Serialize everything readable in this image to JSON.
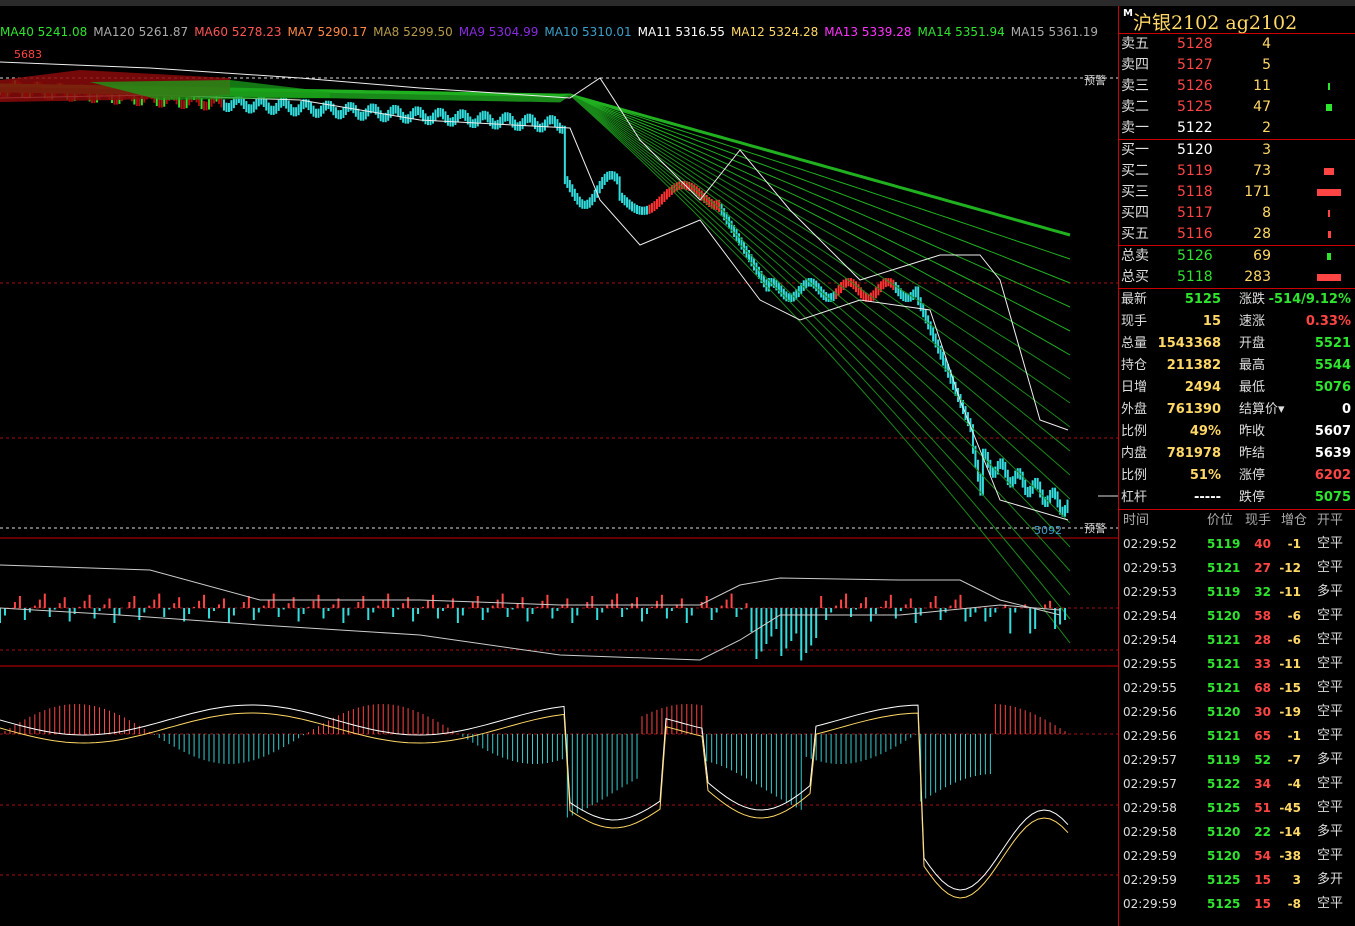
{
  "instrument": {
    "marker": "M",
    "name": "沪银2102  ag2102"
  },
  "ma_legend": [
    {
      "text": "MA40 5241.08",
      "color": "#2ee52e"
    },
    {
      "text": "MA120 5261.87",
      "color": "#aaaaaa"
    },
    {
      "text": "MA60 5278.23",
      "color": "#ff5555"
    },
    {
      "text": "MA7 5290.17",
      "color": "#ff8844"
    },
    {
      "text": "MA8 5299.50",
      "color": "#b59a4a"
    },
    {
      "text": "MA9 5304.99",
      "color": "#8a2be2"
    },
    {
      "text": "MA10 5310.01",
      "color": "#3aa0c8"
    },
    {
      "text": "MA11 5316.55",
      "color": "#ffffff"
    },
    {
      "text": "MA12 5324.28",
      "color": "#ffd866"
    },
    {
      "text": "MA13 5339.28",
      "color": "#ff33ff"
    },
    {
      "text": "MA14 5351.94",
      "color": "#2ee52e"
    },
    {
      "text": "MA15 5361.19",
      "color": "#aaaaaa"
    }
  ],
  "chart": {
    "high_label": "5683",
    "low_label": "5092",
    "alert_label": "预警"
  },
  "orderbook": {
    "asks": [
      {
        "label": "卖五",
        "price": "5128",
        "vol": "4",
        "bar": 0
      },
      {
        "label": "卖四",
        "price": "5127",
        "vol": "5",
        "bar": 0
      },
      {
        "label": "卖三",
        "price": "5126",
        "vol": "11",
        "bar": 2
      },
      {
        "label": "卖二",
        "price": "5125",
        "vol": "47",
        "bar": 6
      },
      {
        "label": "卖一",
        "price": "5122",
        "vol": "2",
        "bar": 0
      }
    ],
    "bids": [
      {
        "label": "买一",
        "price": "5120",
        "vol": "3",
        "bar": 0
      },
      {
        "label": "买二",
        "price": "5119",
        "vol": "73",
        "bar": 10
      },
      {
        "label": "买三",
        "price": "5118",
        "vol": "171",
        "bar": 24
      },
      {
        "label": "买四",
        "price": "5117",
        "vol": "8",
        "bar": 2
      },
      {
        "label": "买五",
        "price": "5116",
        "vol": "28",
        "bar": 3
      }
    ],
    "totals": [
      {
        "label": "总卖",
        "price": "5126",
        "vol": "69",
        "bar": 4
      },
      {
        "label": "总买",
        "price": "5118",
        "vol": "283",
        "bar": 24
      }
    ]
  },
  "stats": [
    {
      "l1": "最新",
      "v1": "5125",
      "c1": "green",
      "l2": "涨跌",
      "v2": "-514/9.12%",
      "c2": "green"
    },
    {
      "l1": "现手",
      "v1": "15",
      "c1": "yellow",
      "l2": "速涨",
      "v2": "0.33%",
      "c2": "red"
    },
    {
      "l1": "总量",
      "v1": "1543368",
      "c1": "yellow",
      "l2": "开盘",
      "v2": "5521",
      "c2": "green"
    },
    {
      "l1": "持仓",
      "v1": "211382",
      "c1": "yellow",
      "l2": "最高",
      "v2": "5544",
      "c2": "green"
    },
    {
      "l1": "日增",
      "v1": "2494",
      "c1": "yellow",
      "l2": "最低",
      "v2": "5076",
      "c2": "green"
    },
    {
      "l1": "外盘",
      "v1": "761390",
      "c1": "yellow",
      "l2": "结算价▾",
      "v2": "0",
      "c2": "white"
    },
    {
      "l1": "比例",
      "v1": "49%",
      "c1": "yellow",
      "l2": "昨收",
      "v2": "5607",
      "c2": "white"
    },
    {
      "l1": "内盘",
      "v1": "781978",
      "c1": "yellow",
      "l2": "昨结",
      "v2": "5639",
      "c2": "white"
    },
    {
      "l1": "比例",
      "v1": "51%",
      "c1": "yellow",
      "l2": "涨停",
      "v2": "6202",
      "c2": "red"
    },
    {
      "l1": "杠杆",
      "v1": "-----",
      "c1": "white",
      "l2": "跌停",
      "v2": "5075",
      "c2": "green"
    }
  ],
  "ticks_header": {
    "time": "时间",
    "price": "价位",
    "qty": "现手",
    "oi": "增仓",
    "type": "开平"
  },
  "ticks": [
    {
      "time": "02:29:52",
      "price": "5119",
      "pc": "green",
      "qty": "40",
      "qc": "red",
      "oi": "-1",
      "type": "空平"
    },
    {
      "time": "02:29:53",
      "price": "5121",
      "pc": "green",
      "qty": "27",
      "qc": "red",
      "oi": "-12",
      "type": "空平"
    },
    {
      "time": "02:29:53",
      "price": "5119",
      "pc": "green",
      "qty": "32",
      "qc": "green",
      "oi": "-11",
      "type": "多平"
    },
    {
      "time": "02:29:54",
      "price": "5120",
      "pc": "green",
      "qty": "58",
      "qc": "red",
      "oi": "-6",
      "type": "空平"
    },
    {
      "time": "02:29:54",
      "price": "5121",
      "pc": "green",
      "qty": "28",
      "qc": "red",
      "oi": "-6",
      "type": "空平"
    },
    {
      "time": "02:29:55",
      "price": "5121",
      "pc": "green",
      "qty": "33",
      "qc": "red",
      "oi": "-11",
      "type": "空平"
    },
    {
      "time": "02:29:55",
      "price": "5121",
      "pc": "green",
      "qty": "68",
      "qc": "red",
      "oi": "-15",
      "type": "空平"
    },
    {
      "time": "02:29:56",
      "price": "5120",
      "pc": "green",
      "qty": "30",
      "qc": "red",
      "oi": "-19",
      "type": "空平"
    },
    {
      "time": "02:29:56",
      "price": "5121",
      "pc": "green",
      "qty": "65",
      "qc": "red",
      "oi": "-1",
      "type": "空平"
    },
    {
      "time": "02:29:57",
      "price": "5119",
      "pc": "green",
      "qty": "52",
      "qc": "green",
      "oi": "-7",
      "type": "多平"
    },
    {
      "time": "02:29:57",
      "price": "5122",
      "pc": "green",
      "qty": "34",
      "qc": "red",
      "oi": "-4",
      "type": "空平"
    },
    {
      "time": "02:29:58",
      "price": "5125",
      "pc": "green",
      "qty": "51",
      "qc": "red",
      "oi": "-45",
      "type": "空平"
    },
    {
      "time": "02:29:58",
      "price": "5120",
      "pc": "green",
      "qty": "22",
      "qc": "green",
      "oi": "-14",
      "type": "多平"
    },
    {
      "time": "02:29:59",
      "price": "5120",
      "pc": "green",
      "qty": "54",
      "qc": "red",
      "oi": "-38",
      "type": "空平"
    },
    {
      "time": "02:29:59",
      "price": "5125",
      "pc": "green",
      "qty": "15",
      "qc": "red",
      "oi": "3",
      "type": "多开"
    },
    {
      "time": "02:29:59",
      "price": "5125",
      "pc": "green",
      "qty": "15",
      "qc": "red",
      "oi": "-8",
      "type": "空平"
    }
  ]
}
